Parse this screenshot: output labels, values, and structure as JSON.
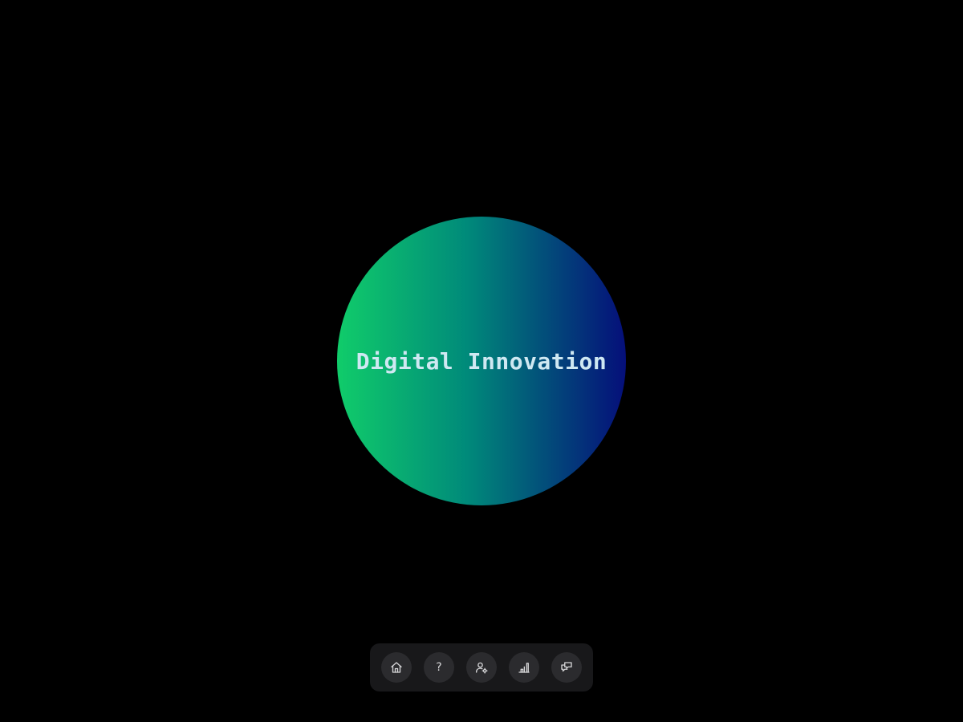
{
  "hero": {
    "title": "Digital Innovation",
    "gradient_start": "#10cc6a",
    "gradient_mid": "#008a7a",
    "gradient_end": "#050f7a",
    "title_color": "#cfe8f2"
  },
  "dock": {
    "icon_color": "#d6d6d8",
    "items": [
      {
        "icon": "home-icon"
      },
      {
        "icon": "question-mark-icon",
        "glyph": "?"
      },
      {
        "icon": "user-settings-icon"
      },
      {
        "icon": "chart-icon"
      },
      {
        "icon": "chat-bubbles-icon"
      }
    ]
  }
}
